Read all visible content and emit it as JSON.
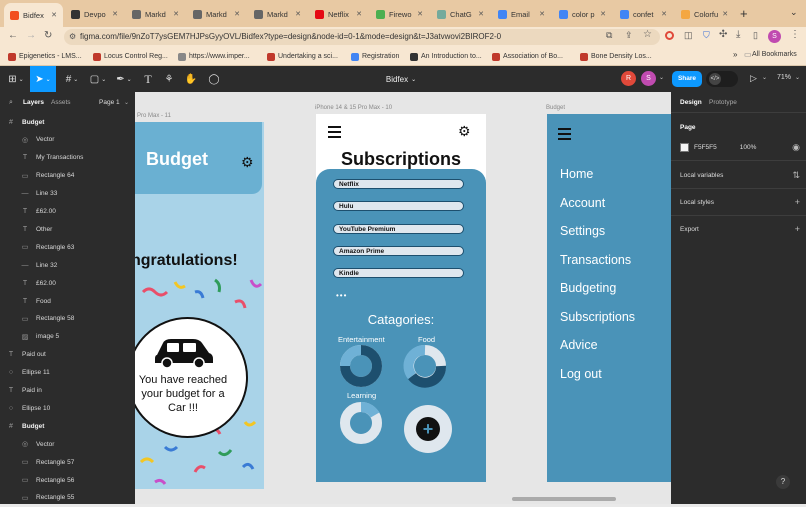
{
  "browser": {
    "tabs": [
      {
        "label": "Bidfex",
        "color": "#f24e1e",
        "active": true
      },
      {
        "label": "Devpo",
        "color": "#333333"
      },
      {
        "label": "Markd",
        "color": "#666666"
      },
      {
        "label": "Markd",
        "color": "#666666"
      },
      {
        "label": "Markd",
        "color": "#666666"
      },
      {
        "label": "Netflix",
        "color": "#e50914"
      },
      {
        "label": "Firewo",
        "color": "#4caf50"
      },
      {
        "label": "ChatG",
        "color": "#74aa9c"
      },
      {
        "label": "Email",
        "color": "#4285f4"
      },
      {
        "label": "color p",
        "color": "#4285f4"
      },
      {
        "label": "confet",
        "color": "#4285f4"
      },
      {
        "label": "Colorfu",
        "color": "#f4a742"
      }
    ],
    "new_tab": "+",
    "url": "figma.com/file/9nZoT7ysGEM7HJPsGyyOVL/Bidfex?type=design&node-id=0-1&mode=design&t=J3atvwovi2BIROF2-0",
    "profile_initial": "S",
    "bookmarks": [
      {
        "label": "Epigenetics - LMS...",
        "color": "#c0392b"
      },
      {
        "label": "Locus Control Reg...",
        "color": "#c0392b"
      },
      {
        "label": "https://www.imper...",
        "color": "#888888"
      },
      {
        "label": "Undertaking a sci...",
        "color": "#c0392b"
      },
      {
        "label": "Registration",
        "color": "#4285f4"
      },
      {
        "label": "An Introduction to...",
        "color": "#333333"
      },
      {
        "label": "Association of Bo...",
        "color": "#c0392b"
      },
      {
        "label": "Bone Density Los...",
        "color": "#c0392b"
      }
    ],
    "more_bookmarks": "»",
    "all_bookmarks": "All Bookmarks"
  },
  "figma": {
    "file_name": "Bidfex",
    "share_label": "Share",
    "zoom": "71%",
    "avatars": [
      {
        "initial": "R",
        "color": "#e0493a"
      },
      {
        "initial": "S",
        "color": "#c04bb0"
      }
    ],
    "left_tabs": {
      "layers": "Layers",
      "assets": "Assets",
      "page": "Page 1"
    },
    "layers": [
      {
        "name": "Budget",
        "icon": "#",
        "indent": 0,
        "frame": true
      },
      {
        "name": "Vector",
        "icon": "◎",
        "indent": 1
      },
      {
        "name": "My Transactions",
        "icon": "T",
        "indent": 1
      },
      {
        "name": "Rectangle 64",
        "icon": "▭",
        "indent": 1
      },
      {
        "name": "Line 33",
        "icon": "—",
        "indent": 1
      },
      {
        "name": "£62.00",
        "icon": "T",
        "indent": 1
      },
      {
        "name": "Other",
        "icon": "T",
        "indent": 1
      },
      {
        "name": "Rectangle 63",
        "icon": "▭",
        "indent": 1
      },
      {
        "name": "Line 32",
        "icon": "—",
        "indent": 1
      },
      {
        "name": "£62.00",
        "icon": "T",
        "indent": 1
      },
      {
        "name": "Food",
        "icon": "T",
        "indent": 1
      },
      {
        "name": "Rectangle 58",
        "icon": "▭",
        "indent": 1
      },
      {
        "name": "image 5",
        "icon": "▨",
        "indent": 1
      },
      {
        "name": "Paid out",
        "icon": "T",
        "indent": 0
      },
      {
        "name": "Ellipse 11",
        "icon": "○",
        "indent": 0
      },
      {
        "name": "Paid in",
        "icon": "T",
        "indent": 0
      },
      {
        "name": "Ellipse 10",
        "icon": "○",
        "indent": 0
      },
      {
        "name": "Budget",
        "icon": "#",
        "indent": 0,
        "frame": true
      },
      {
        "name": "Vector",
        "icon": "◎",
        "indent": 1
      },
      {
        "name": "Rectangle 57",
        "icon": "▭",
        "indent": 1
      },
      {
        "name": "Rectangle 56",
        "icon": "▭",
        "indent": 1
      },
      {
        "name": "Rectangle 55",
        "icon": "▭",
        "indent": 1
      }
    ],
    "right_tabs": {
      "design": "Design",
      "prototype": "Prototype"
    },
    "right_panel": {
      "page_heading": "Page",
      "page_color": "F5F5F5",
      "page_opacity": "100%",
      "local_variables": "Local variables",
      "local_styles": "Local styles",
      "export": "Export"
    },
    "help": "?"
  },
  "frames": {
    "frame1": {
      "label": "Pro Max - 11",
      "title": "Budget",
      "congrats": "ngratulations!",
      "message": "You have reached your budget for a Car !!!"
    },
    "frame2": {
      "label": "iPhone 14 & 15 Pro Max - 10",
      "title": "Subscriptions",
      "subscriptions": [
        "Netflix",
        "Hulu",
        "YouTube Premium",
        "Amazon Prime",
        "Kindle"
      ],
      "more": "•••",
      "categories_title": "Catagories:",
      "categories": [
        "Entertainment",
        "Food",
        "Learning"
      ],
      "add_glyph": "+"
    },
    "frame3": {
      "label": "Budget",
      "menu": [
        "Home",
        "Account",
        "Settings",
        "Transactions",
        "Budgeting",
        "Subscriptions",
        "Advice",
        "Log out"
      ]
    }
  },
  "colors": {
    "figma_dark": "#2c2c2c",
    "accent_blue": "#0d99ff",
    "app_blue": "#4a93b8",
    "app_light": "#a9d3e8",
    "tab_strip": "#e8c9a3"
  }
}
